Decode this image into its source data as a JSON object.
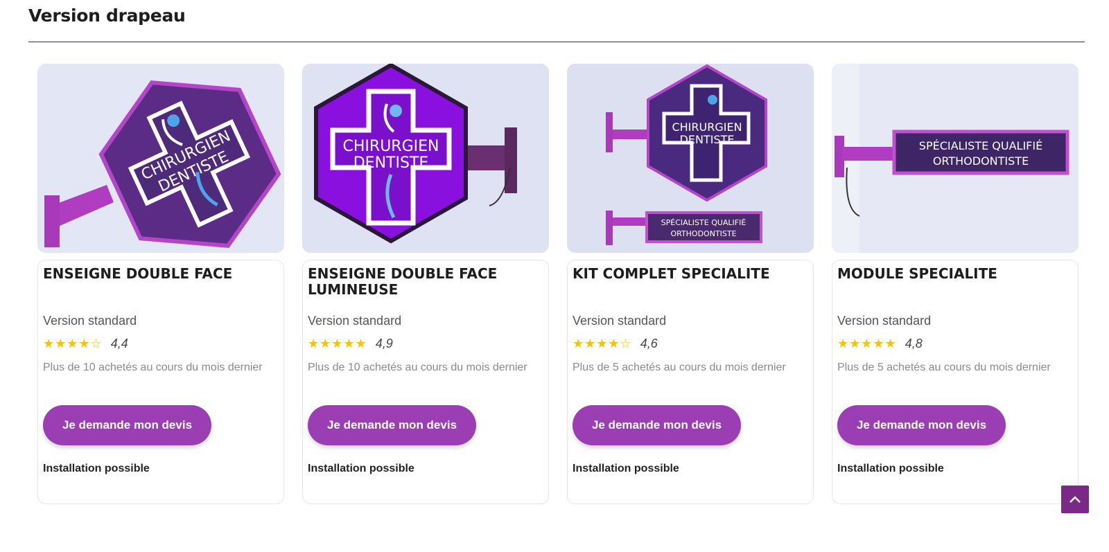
{
  "section": {
    "title": "Version drapeau"
  },
  "products": [
    {
      "name": "ENSEIGNE DOUBLE FACE",
      "version": "Version standard",
      "stars": "★★★★☆",
      "rating": "4,4",
      "bought": "Plus de 10 achetés au cours du mois dernier",
      "cta": "Je demande mon devis",
      "install": "Installation possible",
      "image_text": [
        "CHIRURGIEN",
        "DENTISTE"
      ]
    },
    {
      "name": "ENSEIGNE DOUBLE FACE LUMINEUSE",
      "version": "Version standard",
      "stars": "★★★★★",
      "rating": "4,9",
      "bought": "Plus de 10 achetés au cours du mois dernier",
      "cta": "Je demande mon devis",
      "install": "Installation possible",
      "image_text": [
        "CHIRURGIEN",
        "DENTISTE"
      ]
    },
    {
      "name": "KIT COMPLET SPECIALITE",
      "version": "Version standard",
      "stars": "★★★★☆",
      "rating": "4,6",
      "bought": "Plus de 5 achetés au cours du mois dernier",
      "cta": "Je demande mon devis",
      "install": "Installation possible",
      "image_text": [
        "CHIRURGIEN",
        "DENTISTE",
        "SPÉCIALISTE QUALIFIÉ",
        "ORTHODONTISTE"
      ]
    },
    {
      "name": "MODULE SPECIALITE",
      "version": "Version standard",
      "stars": "★★★★★",
      "rating": "4,8",
      "bought": "Plus de 5 achetés au cours du mois dernier",
      "cta": "Je demande mon devis",
      "install": "Installation possible",
      "image_text": [
        "SPÉCIALISTE QUALIFIÉ",
        "ORTHODONTISTE"
      ]
    }
  ],
  "colors": {
    "accent": "#9b3db3",
    "star": "#f5c400",
    "back_to_top": "#7a2a86",
    "sign_purple": "#8a10e0",
    "sign_dark": "#4a2a6e"
  },
  "icons": {
    "back_to_top": "chevron-up-icon"
  }
}
